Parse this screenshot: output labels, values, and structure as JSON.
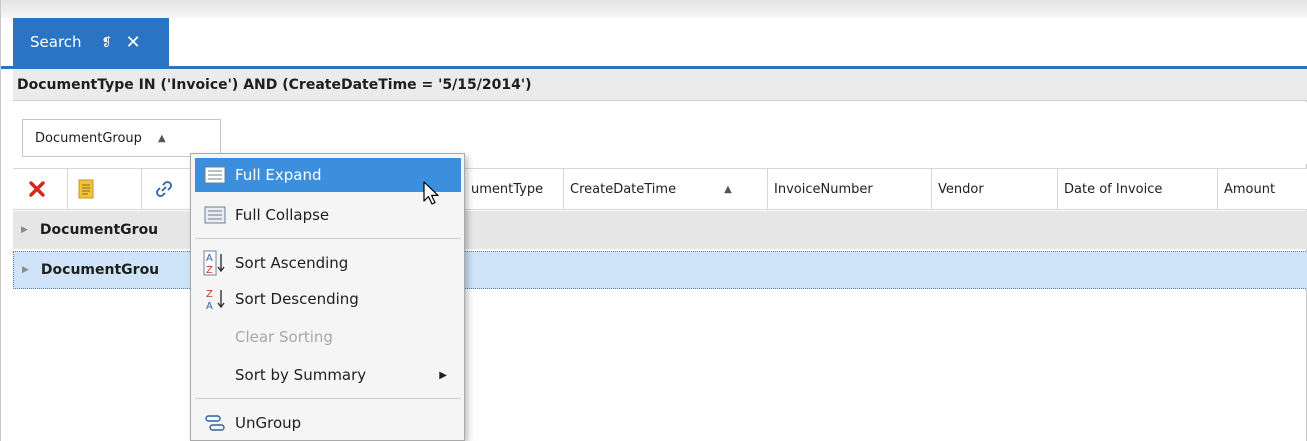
{
  "tab": {
    "title": "Search",
    "pin_glyph": "❡",
    "close_glyph": "✕"
  },
  "filter": {
    "expression": "DocumentType IN ('Invoice') AND (CreateDateTime = '5/15/2014')"
  },
  "group_panel": {
    "chip_label": "DocumentGroup",
    "chip_sort_glyph": "▲"
  },
  "columns": {
    "icons": [
      "delete-icon",
      "document-icon",
      "link-icon"
    ],
    "headers": [
      "umentType",
      "CreateDateTime",
      "InvoiceNumber",
      "Vendor",
      "Date of Invoice",
      "Amount"
    ],
    "sorted_column_glyph": "▲"
  },
  "rows": [
    {
      "label": "DocumentGrou",
      "expander": "▶"
    },
    {
      "label": "DocumentGrou",
      "expander": "▶"
    }
  ],
  "menu": {
    "full_expand": "Full Expand",
    "full_collapse": "Full Collapse",
    "sort_ascending": "Sort Ascending",
    "sort_descending": "Sort Descending",
    "clear_sorting": "Clear Sorting",
    "sort_by_summary": "Sort by Summary",
    "ungroup": "UnGroup",
    "submenu_arrow": "▶"
  },
  "colors": {
    "accent": "#2b74c4",
    "menu_highlight": "#3c8fdc",
    "selected_row": "#cfe4f8",
    "delete_red": "#d9261c"
  }
}
